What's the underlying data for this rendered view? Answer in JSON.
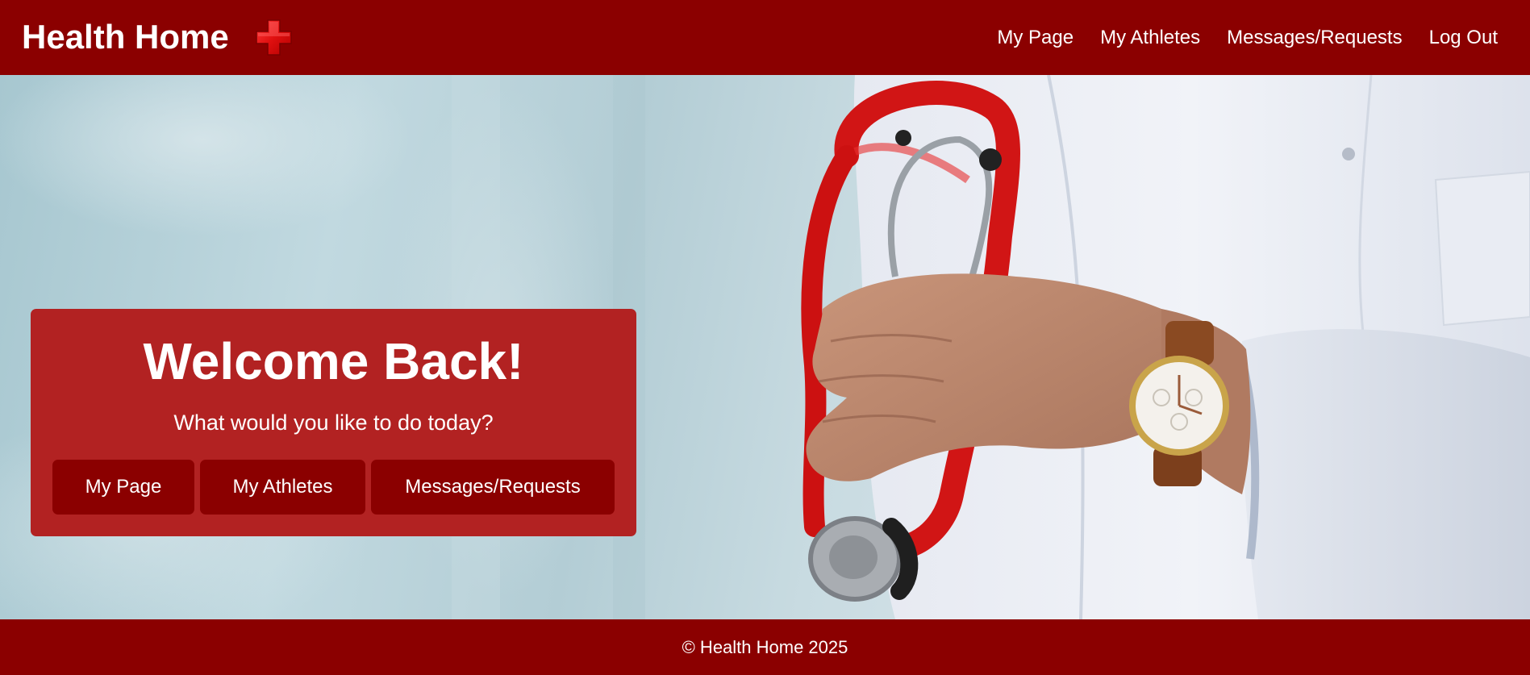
{
  "header": {
    "brand": "Health Home",
    "nav": [
      {
        "label": "My Page"
      },
      {
        "label": "My Athletes"
      },
      {
        "label": "Messages/Requests"
      },
      {
        "label": "Log Out"
      }
    ]
  },
  "hero": {
    "card": {
      "title": "Welcome Back!",
      "subtitle": "What would you like to do today?",
      "buttons": [
        {
          "label": "My Page"
        },
        {
          "label": "My Athletes"
        },
        {
          "label": "Messages/Requests"
        }
      ]
    }
  },
  "footer": {
    "copyright": "© Health Home 2025"
  },
  "colors": {
    "primary": "#8b0000",
    "card": "#b22222",
    "text": "#ffffff"
  },
  "icons": {
    "logo": "red-cross-icon"
  }
}
